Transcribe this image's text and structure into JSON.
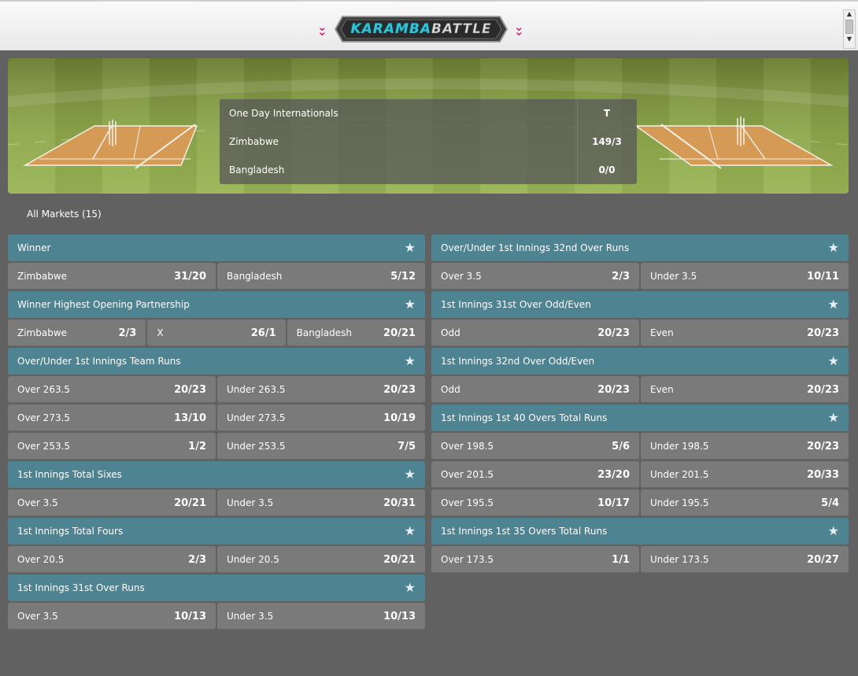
{
  "header": {
    "logo_part1": "KARAMBA",
    "logo_part2": "BATTLE",
    "left_chevron_icon": "double-chevron-down-icon",
    "right_chevron_icon": "double-chevron-down-icon",
    "accent_color": "#c0287a"
  },
  "scoreboard": {
    "competition": "One Day Internationals",
    "status": "T",
    "teams": [
      {
        "name": "Zimbabwe",
        "score": "149/3"
      },
      {
        "name": "Bangladesh",
        "score": "0/0"
      }
    ]
  },
  "markets_tab": {
    "label": "All Markets (15)"
  },
  "colors": {
    "market_header": "#4e8391",
    "selection": "#7a7a7a",
    "background": "#616161"
  },
  "left_markets": [
    {
      "title": "Winner",
      "rows": [
        [
          {
            "label": "Zimbabwe",
            "odds": "31/20"
          },
          {
            "label": "Bangladesh",
            "odds": "5/12"
          }
        ]
      ]
    },
    {
      "title": "Winner Highest Opening Partnership",
      "rows": [
        [
          {
            "label": "Zimbabwe",
            "odds": "2/3"
          },
          {
            "label": "X",
            "odds": "26/1"
          },
          {
            "label": "Bangladesh",
            "odds": "20/21"
          }
        ]
      ]
    },
    {
      "title": "Over/Under 1st Innings Team Runs",
      "rows": [
        [
          {
            "label": "Over 263.5",
            "odds": "20/23"
          },
          {
            "label": "Under 263.5",
            "odds": "20/23"
          }
        ],
        [
          {
            "label": "Over 273.5",
            "odds": "13/10"
          },
          {
            "label": "Under 273.5",
            "odds": "10/19"
          }
        ],
        [
          {
            "label": "Over 253.5",
            "odds": "1/2"
          },
          {
            "label": "Under 253.5",
            "odds": "7/5"
          }
        ]
      ]
    },
    {
      "title": "1st Innings Total Sixes",
      "rows": [
        [
          {
            "label": "Over 3.5",
            "odds": "20/21"
          },
          {
            "label": "Under 3.5",
            "odds": "20/31"
          }
        ]
      ]
    },
    {
      "title": "1st Innings Total Fours",
      "rows": [
        [
          {
            "label": "Over 20.5",
            "odds": "2/3"
          },
          {
            "label": "Under 20.5",
            "odds": "20/21"
          }
        ]
      ]
    },
    {
      "title": "1st Innings 31st Over Runs",
      "rows": [
        [
          {
            "label": "Over 3.5",
            "odds": "10/13"
          },
          {
            "label": "Under 3.5",
            "odds": "10/13"
          }
        ]
      ]
    }
  ],
  "right_markets": [
    {
      "title": "Over/Under 1st Innings 32nd Over Runs",
      "rows": [
        [
          {
            "label": "Over 3.5",
            "odds": "2/3"
          },
          {
            "label": "Under 3.5",
            "odds": "10/11"
          }
        ]
      ]
    },
    {
      "title": "1st Innings 31st Over Odd/Even",
      "rows": [
        [
          {
            "label": "Odd",
            "odds": "20/23"
          },
          {
            "label": "Even",
            "odds": "20/23"
          }
        ]
      ]
    },
    {
      "title": "1st Innings 32nd Over Odd/Even",
      "rows": [
        [
          {
            "label": "Odd",
            "odds": "20/23"
          },
          {
            "label": "Even",
            "odds": "20/23"
          }
        ]
      ]
    },
    {
      "title": "1st Innings 1st 40 Overs Total Runs",
      "rows": [
        [
          {
            "label": "Over 198.5",
            "odds": "5/6"
          },
          {
            "label": "Under 198.5",
            "odds": "20/23"
          }
        ],
        [
          {
            "label": "Over 201.5",
            "odds": "23/20"
          },
          {
            "label": "Under 201.5",
            "odds": "20/33"
          }
        ],
        [
          {
            "label": "Over 195.5",
            "odds": "10/17"
          },
          {
            "label": "Under 195.5",
            "odds": "5/4"
          }
        ]
      ]
    },
    {
      "title": "1st Innings 1st 35 Overs Total Runs",
      "rows": [
        [
          {
            "label": "Over 173.5",
            "odds": "1/1"
          },
          {
            "label": "Under 173.5",
            "odds": "20/27"
          }
        ]
      ]
    }
  ]
}
